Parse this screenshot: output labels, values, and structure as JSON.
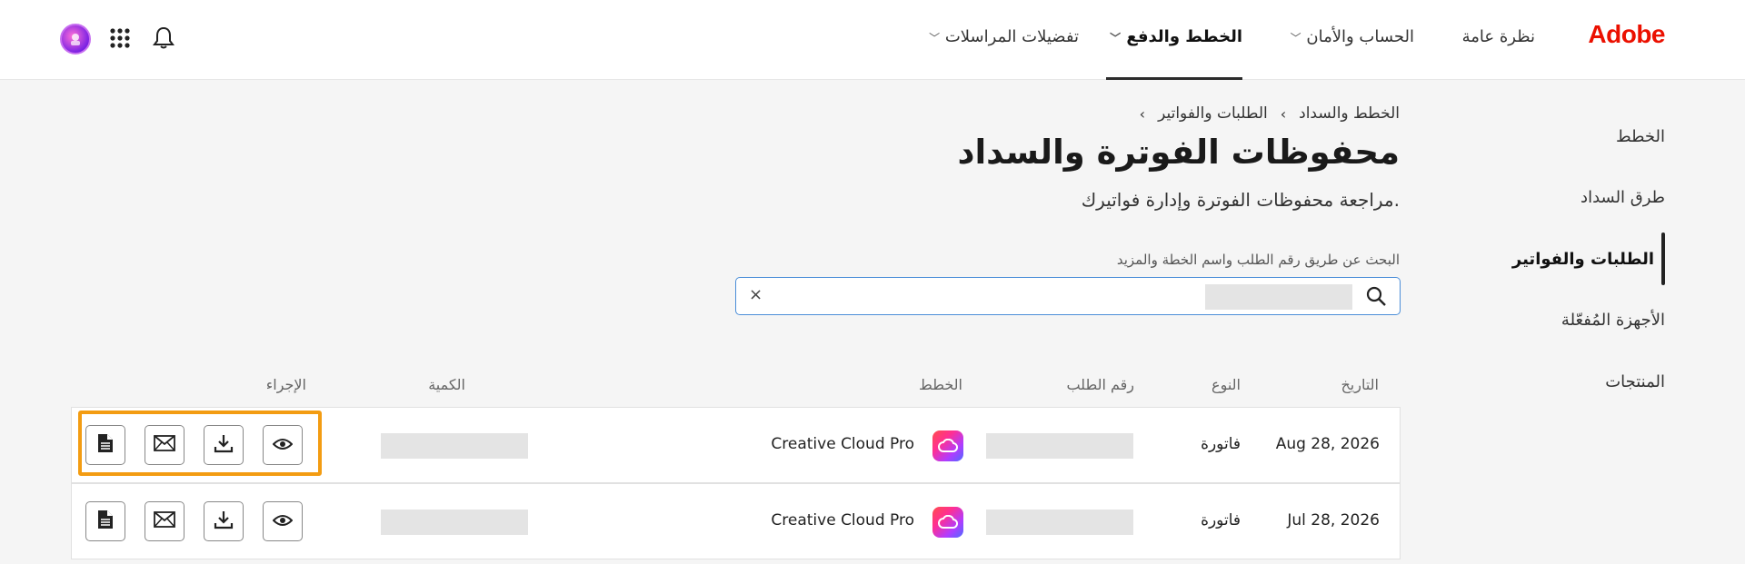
{
  "header": {
    "logo": "Adobe",
    "nav": [
      {
        "label": "نظرة عامة"
      },
      {
        "label": "الحساب والأمان"
      },
      {
        "label": "الخطط والدفع"
      },
      {
        "label": "تفضيلات المراسلات"
      }
    ],
    "icons": [
      "bell-icon",
      "apps-grid-icon",
      "avatar"
    ]
  },
  "sidebar": {
    "items": [
      {
        "label": "الخطط"
      },
      {
        "label": "طرق السداد"
      },
      {
        "label": "الطلبات والفواتير"
      },
      {
        "label": "الأجهزة المُفعّلة"
      },
      {
        "label": "المنتجات"
      }
    ]
  },
  "breadcrumb": {
    "items": [
      "الخطط والسداد",
      "الطلبات والفواتير"
    ]
  },
  "page": {
    "title": "محفوظات الفوترة والسداد",
    "subtitle": "مراجعة محفوظات الفوترة وإدارة فواتيرك."
  },
  "search": {
    "label": "البحث عن طريق رقم الطلب واسم الخطة والمزيد",
    "clear": "×"
  },
  "table": {
    "headers": {
      "date": "التاريخ",
      "type": "النوع",
      "order": "رقم الطلب",
      "plan": "الخطط",
      "amount": "الكمية",
      "action": "الإجراء"
    },
    "rows": [
      {
        "date": "Aug 28, 2026",
        "type": "فاتورة",
        "plan": "Creative Cloud Pro"
      },
      {
        "date": "Jul 28, 2026",
        "type": "فاتورة",
        "plan": "Creative Cloud Pro"
      }
    ]
  },
  "colors": {
    "brand": "#eb1000",
    "highlight": "#f39c12",
    "focus": "#4b8ed8"
  }
}
